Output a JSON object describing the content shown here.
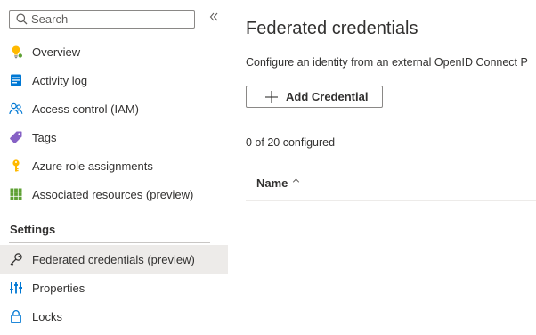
{
  "sidebar": {
    "search": {
      "placeholder": "Search",
      "value": ""
    },
    "collapse_glyph": "«",
    "items": [
      {
        "label": "Overview",
        "icon": "lightbulb-icon"
      },
      {
        "label": "Activity log",
        "icon": "activity-log-icon"
      },
      {
        "label": "Access control (IAM)",
        "icon": "people-icon"
      },
      {
        "label": "Tags",
        "icon": "tag-icon"
      },
      {
        "label": "Azure role assignments",
        "icon": "key-icon"
      },
      {
        "label": "Associated resources (preview)",
        "icon": "grid-icon"
      }
    ],
    "settings_header": "Settings",
    "settings_items": [
      {
        "label": "Federated credentials (preview)",
        "icon": "key-outline-icon",
        "selected": true
      },
      {
        "label": "Properties",
        "icon": "properties-icon"
      },
      {
        "label": "Locks",
        "icon": "lock-icon"
      }
    ]
  },
  "main": {
    "title": "Federated credentials",
    "description": "Configure an identity from an external OpenID Connect P",
    "add_button_label": "Add Credential",
    "count_text": "0 of 20 configured",
    "table": {
      "columns": [
        {
          "label": "Name",
          "sort": "ascending"
        }
      ],
      "rows": []
    }
  },
  "colors": {
    "accent": "#0078d4",
    "selected_bg": "#edebe9",
    "text": "#323130",
    "border": "#8a8886",
    "yellow": "#ffb900",
    "purple": "#8661c5",
    "green": "#5ea033"
  }
}
